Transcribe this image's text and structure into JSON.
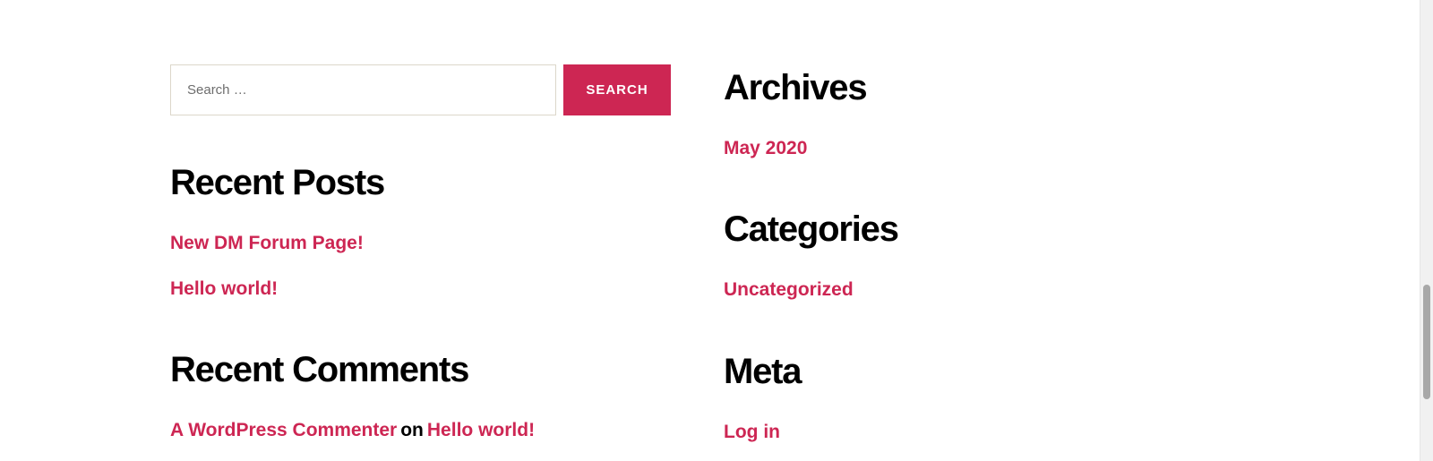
{
  "search": {
    "placeholder": "Search …",
    "value": "",
    "button_label": "Search"
  },
  "recent_posts": {
    "title": "Recent Posts",
    "items": [
      {
        "label": "New DM Forum Page!"
      },
      {
        "label": "Hello world!"
      }
    ]
  },
  "recent_comments": {
    "title": "Recent Comments",
    "items": [
      {
        "author": "A WordPress Commenter",
        "connector": "on",
        "post": "Hello world!"
      }
    ]
  },
  "archives": {
    "title": "Archives",
    "items": [
      {
        "label": "May 2020"
      }
    ]
  },
  "categories": {
    "title": "Categories",
    "items": [
      {
        "label": "Uncategorized"
      }
    ]
  },
  "meta": {
    "title": "Meta",
    "items": [
      {
        "label": "Log in"
      }
    ]
  },
  "colors": {
    "accent": "#cd2653",
    "heading": "#000000",
    "background": "#ffffff",
    "input_border": "#dcd7ca"
  }
}
